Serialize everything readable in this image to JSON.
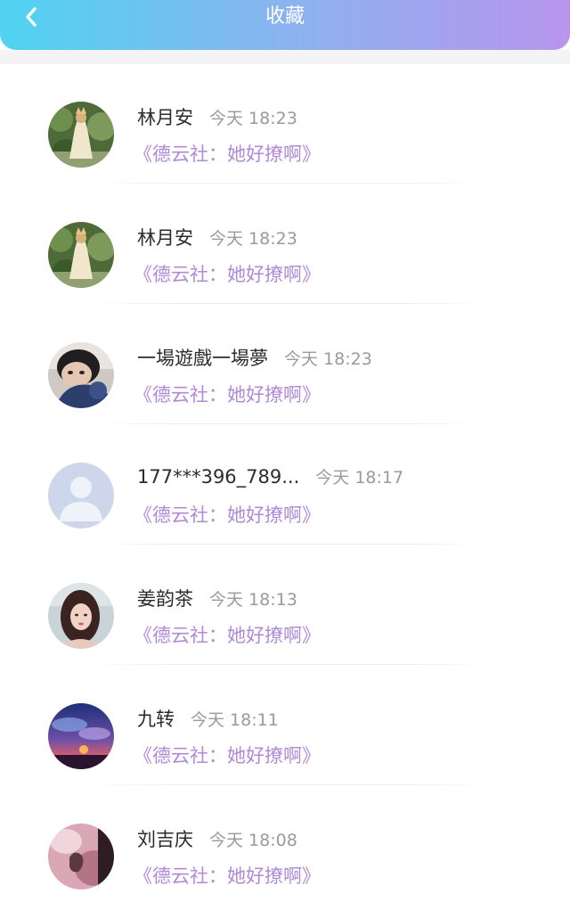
{
  "header": {
    "title": "收藏",
    "back_icon": "chevron-left-icon",
    "gradient": [
      "#4fd3f0",
      "#8fb0ef",
      "#b895ec"
    ]
  },
  "items": [
    {
      "name": "林月安",
      "time": "今天 18:23",
      "work": "《德云社：她好撩啊》",
      "avatar": "girl-in-garden"
    },
    {
      "name": "林月安",
      "time": "今天 18:23",
      "work": "《德云社：她好撩啊》",
      "avatar": "girl-in-garden"
    },
    {
      "name": "一場遊戲一場夢",
      "time": "今天 18:23",
      "work": "《德云社：她好撩啊》",
      "avatar": "boy-with-hood"
    },
    {
      "name": "177***396_789...",
      "time": "今天 18:17",
      "work": "《德云社：她好撩啊》",
      "avatar": "default-user"
    },
    {
      "name": "姜韵茶",
      "time": "今天 18:13",
      "work": "《德云社：她好撩啊》",
      "avatar": "woman-portrait"
    },
    {
      "name": "九转",
      "time": "今天 18:11",
      "work": "《德云社：她好撩啊》",
      "avatar": "sunset-sky"
    },
    {
      "name": "刘吉庆",
      "time": "今天 18:08",
      "work": "《德云社：她好撩啊》",
      "avatar": "pink-photo"
    }
  ],
  "colors": {
    "name": "#2b2b2b",
    "time": "#9a9a9a",
    "work": "#b089d8"
  }
}
